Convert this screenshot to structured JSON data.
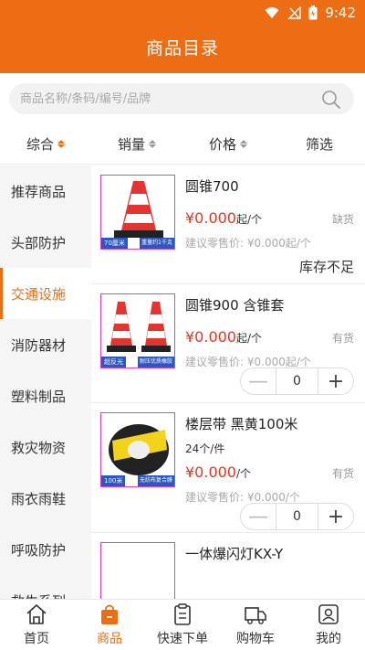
{
  "status": {
    "time": "9:42"
  },
  "header": {
    "title": "商品目录"
  },
  "search": {
    "placeholder": "商品名称/条码/编号/品牌"
  },
  "sort": [
    {
      "label": "综合",
      "active": true
    },
    {
      "label": "销量"
    },
    {
      "label": "价格"
    },
    {
      "label": "筛选"
    }
  ],
  "sidebar": {
    "items": [
      {
        "label": "推荐商品"
      },
      {
        "label": "头部防护"
      },
      {
        "label": "交通设施"
      },
      {
        "label": "消防器材"
      },
      {
        "label": "塑料制品"
      },
      {
        "label": "救灾物资"
      },
      {
        "label": "雨衣雨鞋"
      },
      {
        "label": "呼吸防护"
      },
      {
        "label": "救生系列"
      }
    ],
    "active_index": 2
  },
  "products": [
    {
      "name": "圆锥700",
      "price": "¥0.000",
      "unit": "起/个",
      "stock": "缺货",
      "suggest": "建议零售价: ¥0.000起/个",
      "status": "库存不足",
      "thumb_tags": [
        "70厘米",
        "重量约1千克"
      ]
    },
    {
      "name": "圆锥900 含锥套",
      "price": "¥0.000",
      "unit": "起/个",
      "stock": "有货",
      "suggest": "建议零售价: ¥0.000起/个",
      "qty": "0",
      "thumb_tags": [
        "超反光",
        "耐压优质橡胶"
      ]
    },
    {
      "name": "楼层带 黑黄100米",
      "spec": "24个/件",
      "price": "¥0.000",
      "unit": "/个",
      "stock": "有货",
      "suggest": "建议零售价: ¥0.000/个",
      "qty": "0",
      "thumb_tags": [
        "100米",
        "无纺布复合膜"
      ]
    },
    {
      "name": "一体爆闪灯KX-Y"
    }
  ],
  "bottom_nav": [
    {
      "label": "首页",
      "icon": "home-icon"
    },
    {
      "label": "商品",
      "icon": "bag-icon",
      "active": true
    },
    {
      "label": "快速下单",
      "icon": "clipboard-icon"
    },
    {
      "label": "购物车",
      "icon": "truck-icon"
    },
    {
      "label": "我的",
      "icon": "user-icon"
    }
  ],
  "colors": {
    "accent": "#ec6d14",
    "price": "#e8341c"
  }
}
